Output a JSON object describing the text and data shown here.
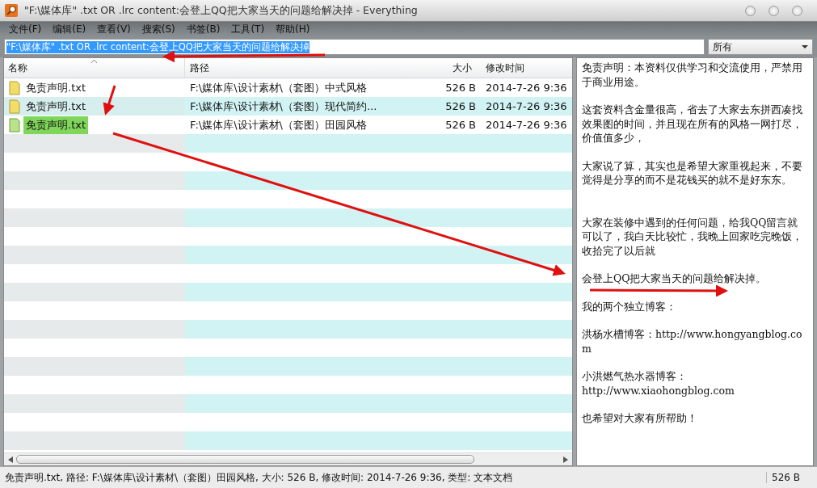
{
  "window": {
    "title": "\"F:\\媒体库\" .txt OR .lrc  content:会登上QQ把大家当天的问题给解决掉 - Everything"
  },
  "menu": [
    "文件(F)",
    "编辑(E)",
    "查看(V)",
    "搜索(S)",
    "书签(B)",
    "工具(T)",
    "帮助(H)"
  ],
  "search": {
    "value": "\"F:\\媒体库\" .txt OR .lrc  content:会登上QQ把大家当天的问题给解决掉",
    "text_selected": true
  },
  "filter": {
    "value": "所有"
  },
  "table": {
    "columns": [
      "名称",
      "路径",
      "大小",
      "修改时间"
    ],
    "rows": [
      {
        "name": "免责声明.txt",
        "path": "F:\\媒体库\\设计素材\\（套图）中式风格",
        "size": "526 B",
        "modified": "2014-7-26 9:36",
        "selected": false
      },
      {
        "name": "免责声明.txt",
        "path": "F:\\媒体库\\设计素材\\（套图）现代简约...",
        "size": "526 B",
        "modified": "2014-7-26 9:36",
        "selected": false
      },
      {
        "name": "免责声明.txt",
        "path": "F:\\媒体库\\设计素材\\（套图）田园风格",
        "size": "526 B",
        "modified": "2014-7-26 9:36",
        "selected": true
      }
    ]
  },
  "preview": {
    "paragraphs": [
      [
        "免责声明：本资料仅供学习和交流使用，严禁用于商业用途。"
      ],
      [
        "这套资料含金量很高，省去了大家去东拼西凑找效果图的时间，并且现在所有的风格一网打尽，价值值多少，"
      ],
      [
        "大家说了算，其实也是希望大家重视起来，不要觉得是分享的而不是花钱买的就不是好东东。"
      ],
      [
        "大家在装修中遇到的任何问题，给我QQ留言就可以了，我白天比较忙，我晚上回家吃完晚饭，收拾完了以后就"
      ],
      [
        "会登上QQ把大家当天的问题给解决掉。"
      ],
      [
        "我的两个独立博客："
      ],
      [
        "洪杨水槽博客：http://www.hongyangblog.com"
      ],
      [
        "小洪燃气热水器博客：",
        "http://www.xiaohongblog.com"
      ],
      [
        "也希望对大家有所帮助！"
      ]
    ]
  },
  "status_bar": {
    "text": "免责声明.txt, 路径: F:\\媒体库\\设计素材\\（套图）田园风格, 大小: 526 B, 修改时间: 2014-7-26 9:36, 类型: 文本文档",
    "size": "526 B"
  }
}
